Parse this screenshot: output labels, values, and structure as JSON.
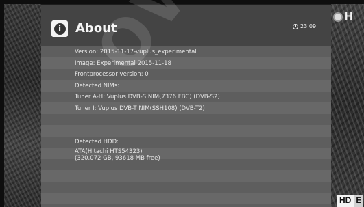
{
  "channel": {
    "logo_text": "H",
    "badge_hd": "HD",
    "badge_tail": "E"
  },
  "header": {
    "title": "About",
    "clock": "23:09"
  },
  "info": {
    "version": "Version: 2015-11-17-vuplus_experimental",
    "image": "Image: Experimental 2015-11-18",
    "frontprocessor": "Frontprocessor version: 0",
    "nims_heading": "Detected NIMs:",
    "tuner_ah": "Tuner A-H: Vuplus DVB-S NIM(7376 FBC) (DVB-S2)",
    "tuner_i": "Tuner I: Vuplus DVB-T NIM(SSH108) (DVB-T2)",
    "hdd_heading": "Detected HDD:",
    "hdd_model": "ATA(Hitachi HTS54323)",
    "hdd_size": "(320.072 GB, 93618 MB free)"
  },
  "watermark": "OWN"
}
